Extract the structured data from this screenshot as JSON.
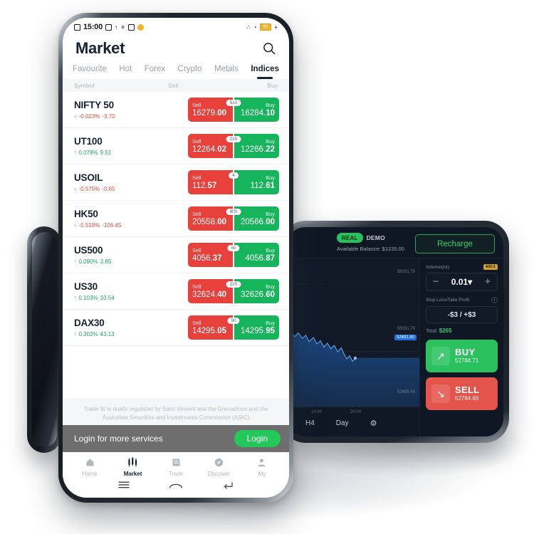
{
  "phone": {
    "status_bar": {
      "time": "15:00",
      "battery": "80",
      "icons": [
        "↑",
        "✳",
        "∴",
        "◔",
        "+"
      ]
    },
    "header": {
      "title": "Market",
      "search_icon": "search-icon"
    },
    "tabs": [
      {
        "label": "Favourite",
        "active": false
      },
      {
        "label": "Hot",
        "active": false
      },
      {
        "label": "Forex",
        "active": false
      },
      {
        "label": "Crypto",
        "active": false
      },
      {
        "label": "Metals",
        "active": false
      },
      {
        "label": "Indices",
        "active": true
      }
    ],
    "columns": [
      "Symbol",
      "Sell",
      "Buy"
    ],
    "sell_label": "Sell",
    "buy_label": "Buy",
    "rows": [
      {
        "symbol": "NIFTY 50",
        "direction": "down",
        "arrow": "↓",
        "change_pct": "-0.023%",
        "change_abs": "-3.70",
        "sell_int": "16279.",
        "sell_frac": "00",
        "buy_int": "16284.",
        "buy_frac": "10",
        "spread": "510"
      },
      {
        "symbol": "UT100",
        "direction": "up",
        "arrow": "↑",
        "change_pct": "0.078%",
        "change_abs": "9.51",
        "sell_int": "12264.",
        "sell_frac": "02",
        "buy_int": "12266.",
        "buy_frac": "22",
        "spread": "220"
      },
      {
        "symbol": "USOIL",
        "direction": "down",
        "arrow": "↓",
        "change_pct": "-0.575%",
        "change_abs": "-0.65",
        "sell_int": "112.",
        "sell_frac": "57",
        "buy_int": "112.",
        "buy_frac": "61",
        "spread": "4"
      },
      {
        "symbol": "HK50",
        "direction": "down",
        "arrow": "↓",
        "change_pct": "-0.518%",
        "change_abs": "-106.45",
        "sell_int": "20558.",
        "sell_frac": "00",
        "buy_int": "20566.",
        "buy_frac": "00",
        "spread": "800"
      },
      {
        "symbol": "US500",
        "direction": "up",
        "arrow": "↑",
        "change_pct": "0.090%",
        "change_abs": "3.65",
        "sell_int": "4056.",
        "sell_frac": "37",
        "buy_int": "4056.",
        "buy_frac": "87",
        "spread": "50"
      },
      {
        "symbol": "US30",
        "direction": "up",
        "arrow": "↑",
        "change_pct": "0.103%",
        "change_abs": "33.54",
        "sell_int": "32624.",
        "sell_frac": "40",
        "buy_int": "32626.",
        "buy_frac": "60",
        "spread": "220"
      },
      {
        "symbol": "DAX30",
        "direction": "up",
        "arrow": "↑",
        "change_pct": "0.302%",
        "change_abs": "43.13",
        "sell_int": "14295.",
        "sell_frac": "05",
        "buy_int": "14295.",
        "buy_frac": "95",
        "spread": "90"
      }
    ],
    "disclaimer": "Trade W is dually regulated by Saint Vincent and the Grenadines and the Australian Securities and Investments Commission (ASIC)",
    "login_banner": {
      "text": "Login for more services",
      "button": "Login"
    },
    "bottom_nav": [
      {
        "label": "Home",
        "active": false
      },
      {
        "label": "Market",
        "active": true
      },
      {
        "label": "Trade",
        "active": false
      },
      {
        "label": "Discover",
        "active": false
      },
      {
        "label": "My",
        "active": false
      }
    ]
  },
  "landscape": {
    "account": {
      "real_label": "REAL",
      "demo_label": "DEMO",
      "balance_text": "Available Balance: $1235.00",
      "recharge_label": "Recharge"
    },
    "chart": {
      "current_price": "52691.80",
      "axis_labels": [
        "58031.70",
        "55031.70",
        "52695.45"
      ],
      "time_labels": [
        "10:00",
        "20:00"
      ],
      "timeframe": "H4",
      "period": "Day",
      "settings_icon": "⚙"
    },
    "order": {
      "volume_label": "Volume(lot)",
      "leverage_badge": "400:1",
      "minus": "−",
      "plus": "+",
      "volume_value": "0.01▾",
      "sl_tp_label": "Stop Loss/Take Profit",
      "info_icon": "i",
      "sl_tp_value": "-$3 / +$3",
      "total_label": "Total:",
      "total_value": "$265",
      "buy": {
        "label": "BUY",
        "price": "52784.71",
        "icon": "↗"
      },
      "sell": {
        "label": "SELL",
        "price": "52784.69",
        "icon": "↘"
      }
    }
  },
  "colors": {
    "sell_red": "#e8403a",
    "buy_green": "#16b45b",
    "accent_green": "#24c759",
    "dark_bg": "#101826",
    "text_dark": "#16222f"
  }
}
